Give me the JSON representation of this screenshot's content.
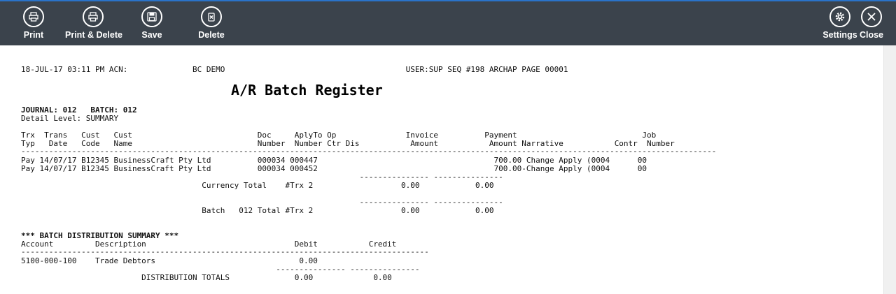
{
  "toolbar": {
    "print_label": "Print",
    "print_delete_label": "Print & Delete",
    "save_label": "Save",
    "delete_label": "Delete",
    "settings_label": "Settings",
    "close_label": "Close",
    "icons": [
      "printer-icon",
      "printer-icon",
      "floppy-disk-icon",
      "trash-icon",
      "gear-icon",
      "close-icon"
    ]
  },
  "report": {
    "header_line": "18-JUL-17 03:11 PM ACN:              BC DEMO                                       USER:SUP SEQ #198 ARCHAP PAGE 00001",
    "title": "A/R Batch Register",
    "journal_line": "JOURNAL: 012   BATCH: 012",
    "detail_level_line": "Detail Level: SUMMARY",
    "col_header_1": "Trx  Trans   Cust   Cust                           Doc     AplyTo Op               Invoice          Payment                           Job",
    "col_header_2": "Typ   Date   Code   Name                           Number  Number Ctr Dis           Amount           Amount Narrative           Contr  Number",
    "rule_line": "------------------------------------------------------------------------------------------------------------------------------------------------------",
    "rows": [
      "Pay 14/07/17 B12345 BusinessCraft Pty Ltd          000034 000447                                      700.00 Change Apply (0004      00",
      "Pay 14/07/17 B12345 BusinessCraft Pty Ltd          000034 000452                                      700.00-Change Apply (0004      00"
    ],
    "dash_line_1": "                                                                         --------------- ---------------",
    "currency_total_line": "                                       Currency Total    #Trx 2                   0.00            0.00",
    "dash_line_2": "                                                                         --------------- ---------------",
    "batch_total_line": "                                       Batch   012 Total #Trx 2                   0.00            0.00",
    "dist_title": "*** BATCH DISTRIBUTION SUMMARY ***",
    "dist_header": "Account         Description                                Debit           Credit",
    "dist_rule": "----------------------------------------------------------------------------------------",
    "dist_row": "5100-000-100    Trade Debtors                               0.00",
    "dist_dash": "                                                       --------------- ---------------",
    "dist_totals": "                          DISTRIBUTION TOTALS              0.00             0.00"
  }
}
